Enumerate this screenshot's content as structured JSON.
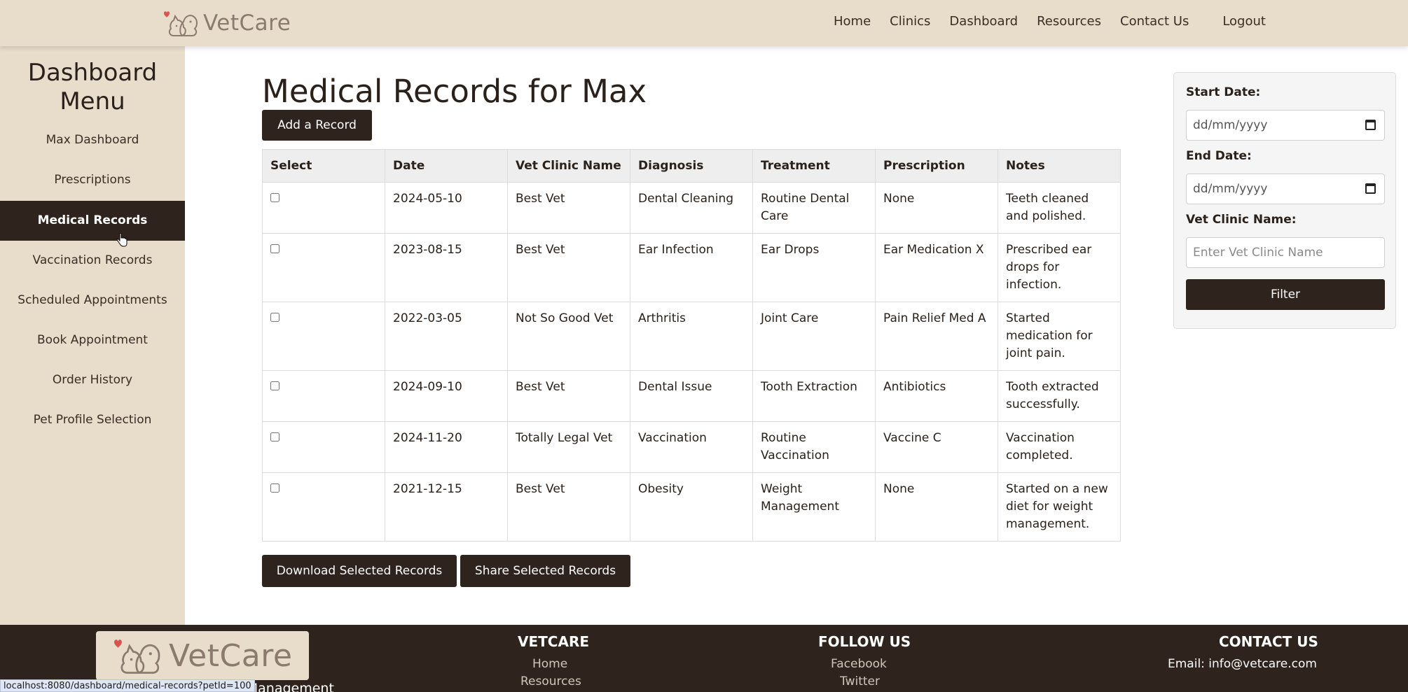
{
  "header": {
    "brand": "VetCare",
    "nav": [
      {
        "label": "Home",
        "key": "home"
      },
      {
        "label": "Clinics",
        "key": "clinics"
      },
      {
        "label": "Dashboard",
        "key": "dashboard"
      },
      {
        "label": "Resources",
        "key": "resources"
      },
      {
        "label": "Contact Us",
        "key": "contact-us"
      },
      {
        "label": "Logout",
        "key": "logout"
      }
    ]
  },
  "sidebar": {
    "title_line1": "Dashboard",
    "title_line2": "Menu",
    "active_item": "Medical Records",
    "items": [
      {
        "label": "Max Dashboard"
      },
      {
        "label": "Prescriptions"
      },
      {
        "label": "Medical Records"
      },
      {
        "label": "Vaccination Records"
      },
      {
        "label": "Scheduled Appointments"
      },
      {
        "label": "Book Appointment"
      },
      {
        "label": "Order History"
      },
      {
        "label": "Pet Profile Selection"
      }
    ]
  },
  "main": {
    "title": "Medical Records for Max",
    "add_button": "Add a Record",
    "download_button": "Download Selected Records",
    "share_button": "Share Selected Records"
  },
  "table": {
    "columns": [
      "Select",
      "Date",
      "Vet Clinic Name",
      "Diagnosis",
      "Treatment",
      "Prescription",
      "Notes"
    ],
    "rows": [
      {
        "checked": false,
        "date": "2024-05-10",
        "clinic": "Best Vet",
        "diagnosis": "Dental Cleaning",
        "treatment": [
          "Routine Dental",
          "Care"
        ],
        "prescription": "None",
        "notes": [
          "Teeth cleaned",
          "and polished."
        ]
      },
      {
        "checked": false,
        "date": "2023-08-15",
        "clinic": "Best Vet",
        "diagnosis": "Ear Infection",
        "treatment": [
          "Ear Drops"
        ],
        "prescription": "Ear Medication X",
        "notes": [
          "Prescribed ear",
          "drops for",
          "infection."
        ]
      },
      {
        "checked": false,
        "date": "2022-03-05",
        "clinic": "Not So Good Vet",
        "diagnosis": "Arthritis",
        "treatment": [
          "Joint Care"
        ],
        "prescription": "Pain Relief Med A",
        "notes": [
          "Started",
          "medication for",
          "joint pain."
        ]
      },
      {
        "checked": false,
        "date": "2024-09-10",
        "clinic": "Best Vet",
        "diagnosis": "Dental Issue",
        "treatment": [
          "Tooth Extraction"
        ],
        "prescription": "Antibiotics",
        "notes": [
          "Tooth extracted",
          "successfully."
        ]
      },
      {
        "checked": false,
        "date": "2024-11-20",
        "clinic": "Totally Legal Vet",
        "diagnosis": "Vaccination",
        "treatment": [
          "Routine",
          "Vaccination"
        ],
        "prescription": "Vaccine C",
        "notes": [
          "Vaccination",
          "completed."
        ]
      },
      {
        "checked": false,
        "date": "2021-12-15",
        "clinic": "Best Vet",
        "diagnosis": "Obesity",
        "treatment": [
          "Weight",
          "Management"
        ],
        "prescription": "None",
        "notes": [
          "Started on a new",
          "diet for weight",
          "management."
        ]
      }
    ]
  },
  "filter": {
    "start_label": "Start Date:",
    "start_value": "dd/mm/yyyy",
    "end_label": "End Date:",
    "end_value": "dd/mm/yyyy",
    "clinic_label": "Vet Clinic Name:",
    "clinic_placeholder": "Enter Vet Clinic Name",
    "button": "Filter"
  },
  "footer": {
    "brand": "VetCare",
    "tagline_fragment": "ic Management",
    "vetcare_heading": "VETCARE",
    "vetcare_links": [
      "Home",
      "Resources"
    ],
    "follow_heading": "FOLLOW US",
    "follow_links": [
      "Facebook",
      "Twitter"
    ],
    "contact_heading": "CONTACT US",
    "email": "Email: info@vetcare.com"
  },
  "status_url": "localhost:8080/dashboard/medical-records?petId=100",
  "colors": {
    "header_bg": "#e8dccb",
    "dark_brown": "#2f241d",
    "logo_text": "#8b7b6e",
    "heart": "#d9534f"
  },
  "icons": {
    "logo": "dog-and-cat-logo-icon",
    "calendar": "calendar-icon",
    "cursor": "hand-pointer-icon"
  }
}
